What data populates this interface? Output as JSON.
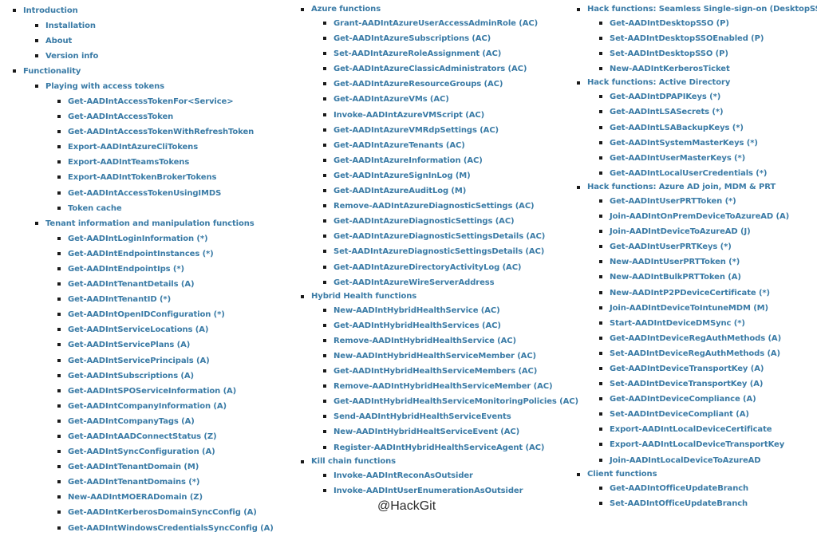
{
  "colors": {
    "link": "#3a7ba6",
    "bullet": "#1a1a1a",
    "watermark": "#2b2b2b"
  },
  "watermark": "@HackGit",
  "col1": {
    "intro": {
      "label": "Introduction",
      "items": [
        "Installation",
        "About",
        "Version info"
      ]
    },
    "functionality": {
      "label": "Functionality",
      "access_tokens": {
        "label": "Playing with access tokens",
        "items": [
          "Get-AADIntAccessTokenFor<Service>",
          "Get-AADIntAccessToken",
          "Get-AADIntAccessTokenWithRefreshToken",
          "Export-AADIntAzureCliTokens",
          "Export-AADIntTeamsTokens",
          "Export-AADIntTokenBrokerTokens",
          "Get-AADIntAccessTokenUsingIMDS",
          "Token cache"
        ]
      },
      "tenant": {
        "label": "Tenant information and manipulation functions",
        "items": [
          "Get-AADIntLoginInformation (*)",
          "Get-AADIntEndpointInstances (*)",
          "Get-AADIntEndpointIps (*)",
          "Get-AADIntTenantDetails (A)",
          "Get-AADIntTenantID (*)",
          "Get-AADIntOpenIDConfiguration (*)",
          "Get-AADIntServiceLocations (A)",
          "Get-AADIntServicePlans (A)",
          "Get-AADIntServicePrincipals (A)",
          "Get-AADIntSubscriptions (A)",
          "Get-AADIntSPOServiceInformation (A)",
          "Get-AADIntCompanyInformation (A)",
          "Get-AADIntCompanyTags (A)",
          "Get-AADIntAADConnectStatus (Z)",
          "Get-AADIntSyncConfiguration (A)",
          "Get-AADIntTenantDomain (M)",
          "Get-AADIntTenantDomains (*)",
          "New-AADIntMOERADomain (Z)",
          "Get-AADIntKerberosDomainSyncConfig (A)",
          "Get-AADIntWindowsCredentialsSyncConfig (A)"
        ]
      }
    }
  },
  "col2": {
    "azure": {
      "label": "Azure functions",
      "items": [
        "Grant-AADIntAzureUserAccessAdminRole (AC)",
        "Get-AADIntAzureSubscriptions (AC)",
        "Set-AADIntAzureRoleAssignment (AC)",
        "Get-AADIntAzureClassicAdministrators (AC)",
        "Get-AADIntAzureResourceGroups (AC)",
        "Get-AADIntAzureVMs (AC)",
        "Invoke-AADIntAzureVMScript (AC)",
        "Get-AADIntAzureVMRdpSettings (AC)",
        "Get-AADIntAzureTenants (AC)",
        "Get-AADIntAzureInformation (AC)",
        "Get-AADIntAzureSignInLog (M)",
        "Get-AADIntAzureAuditLog (M)",
        "Remove-AADIntAzureDiagnosticSettings (AC)",
        "Get-AADIntAzureDiagnosticSettings (AC)",
        "Get-AADIntAzureDiagnosticSettingsDetails (AC)",
        "Set-AADIntAzureDiagnosticSettingsDetails (AC)",
        "Get-AADIntAzureDirectoryActivityLog (AC)",
        "Get-AADIntAzureWireServerAddress"
      ]
    },
    "hybrid": {
      "label": "Hybrid Health functions",
      "items": [
        "New-AADIntHybridHealthService (AC)",
        "Get-AADIntHybridHealthServices (AC)",
        "Remove-AADIntHybridHealthService (AC)",
        "New-AADIntHybridHealthServiceMember (AC)",
        "Get-AADIntHybridHealthServiceMembers (AC)",
        "Remove-AADIntHybridHealthServiceMember (AC)",
        "Get-AADIntHybridHealthServiceMonitoringPolicies (AC)",
        "Send-AADIntHybridHealthServiceEvents",
        "New-AADIntHybridHealtServiceEvent (AC)",
        "Register-AADIntHybridHealthServiceAgent (AC)"
      ]
    },
    "killchain": {
      "label": "Kill chain functions",
      "items": [
        "Invoke-AADIntReconAsOutsider",
        "Invoke-AADIntUserEnumerationAsOutsider"
      ]
    }
  },
  "col3": {
    "sso": {
      "label": "Hack functions: Seamless Single-sign-on (DesktopSSO)",
      "items": [
        "Get-AADIntDesktopSSO (P)",
        "Set-AADIntDesktopSSOEnabled (P)",
        "Set-AADIntDesktopSSO (P)",
        "New-AADIntKerberosTicket"
      ]
    },
    "ad": {
      "label": "Hack functions: Active Directory",
      "items": [
        "Get-AADIntDPAPIKeys (*)",
        "Get-AADIntLSASecrets (*)",
        "Get-AADIntLSABackupKeys (*)",
        "Get-AADIntSystemMasterKeys (*)",
        "Get-AADIntUserMasterKeys (*)",
        "Get-AADIntLocalUserCredentials (*)"
      ]
    },
    "join": {
      "label": "Hack functions: Azure AD join, MDM & PRT",
      "items": [
        "Get-AADIntUserPRTToken (*)",
        "Join-AADIntOnPremDeviceToAzureAD (A)",
        "Join-AADIntDeviceToAzureAD (J)",
        "Get-AADIntUserPRTKeys (*)",
        "New-AADIntUserPRTToken (*)",
        "New-AADIntBulkPRTToken (A)",
        "New-AADIntP2PDeviceCertificate (*)",
        "Join-AADIntDeviceToIntuneMDM (M)",
        "Start-AADIntDeviceDMSync (*)",
        "Get-AADIntDeviceRegAuthMethods (A)",
        "Set-AADIntDeviceRegAuthMethods (A)",
        "Get-AADIntDeviceTransportKey (A)",
        "Set-AADIntDeviceTransportKey (A)",
        "Get-AADIntDeviceCompliance (A)",
        "Set-AADIntDeviceCompliant (A)",
        "Export-AADIntLocalDeviceCertificate",
        "Export-AADIntLocalDeviceTransportKey",
        "Join-AADIntLocalDeviceToAzureAD"
      ]
    },
    "client": {
      "label": "Client functions",
      "items": [
        "Get-AADIntOfficeUpdateBranch",
        "Set-AADIntOfficeUpdateBranch"
      ]
    }
  }
}
